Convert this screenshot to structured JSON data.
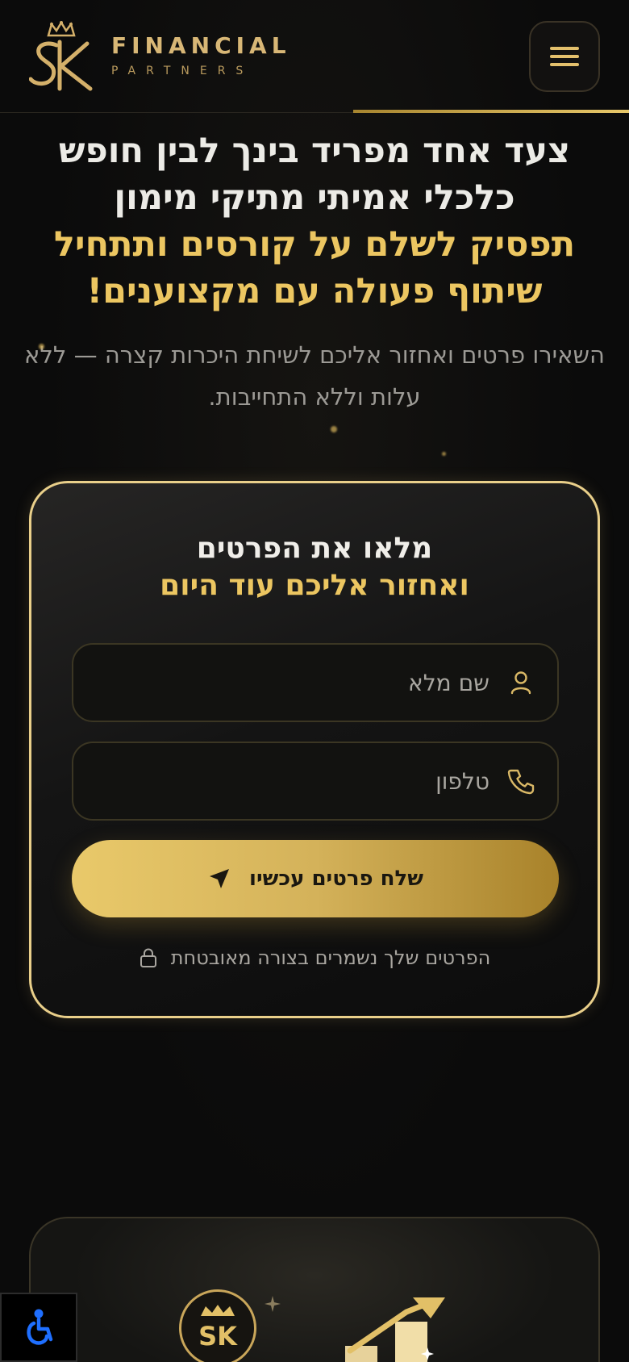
{
  "header": {
    "brand_main": "FINANCIAL",
    "brand_sub": "PARTNERS",
    "logo_letters": "SK",
    "menu_icon": "hamburger-menu-icon"
  },
  "hero": {
    "title_line1": "צעד אחד מפריד בינך לבין חופש",
    "title_line2": "כלכלי אמיתי מתיקי מימון",
    "title_line3": "תפסיק לשלם על קורסים ותתחיל",
    "title_line4": "שיתוף פעולה עם מקצוענים!",
    "subtitle": "השאירו פרטים ואחזור אליכם לשיחת היכרות קצרה — ללא עלות וללא התחייבות."
  },
  "form": {
    "title": "מלאו את הפרטים",
    "title_highlight": "ואחזור אליכם עוד היום",
    "name_placeholder": "שם מלא",
    "name_value": "",
    "phone_placeholder": "טלפון",
    "phone_value": "",
    "submit_label": "שלח פרטים עכשיו",
    "secure_note": "הפרטים שלך נשמרים בצורה מאובטחת"
  },
  "bottom_card": {
    "badge_text": "SK"
  },
  "colors": {
    "gold": "#ecc661",
    "gold_dark": "#a8822a",
    "background": "#0b0b0b"
  }
}
